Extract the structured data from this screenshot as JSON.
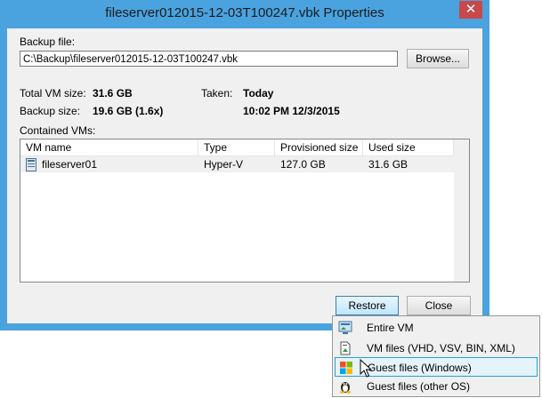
{
  "window": {
    "title": "fileserver012015-12-03T100247.vbk Properties",
    "close_glyph": "✕"
  },
  "backup_file": {
    "label": "Backup file:",
    "path": "C:\\Backup\\fileserver012015-12-03T100247.vbk",
    "browse_label": "Browse..."
  },
  "summary": {
    "total_vm_size_label": "Total VM size:",
    "total_vm_size_value": "31.6 GB",
    "backup_size_label": "Backup size:",
    "backup_size_value": "19.6 GB (1.6x)",
    "taken_label": "Taken:",
    "taken_day": "Today",
    "taken_time": "10:02 PM 12/3/2015"
  },
  "vms": {
    "label": "Contained VMs:",
    "columns": [
      "VM name",
      "Type",
      "Provisioned size",
      "Used size"
    ],
    "rows": [
      {
        "name": "fileserver01",
        "type": "Hyper-V",
        "provisioned": "127.0 GB",
        "used": "31.6 GB",
        "icon": "vm-icon"
      }
    ]
  },
  "buttons": {
    "restore": "Restore",
    "close": "Close"
  },
  "restore_menu": {
    "items": [
      {
        "label": "Entire VM",
        "icon": "entire-vm-icon"
      },
      {
        "label": "VM files (VHD, VSV, BIN, XML)",
        "icon": "vm-files-icon"
      },
      {
        "label": "Guest files (Windows)",
        "icon": "windows-icon",
        "highlighted": true
      },
      {
        "label": "Guest files (other OS)",
        "icon": "linux-icon"
      }
    ]
  },
  "colors": {
    "window_frame": "#4aa3df",
    "close_button": "#c7494b",
    "menu_highlight": "#e5f3fb"
  }
}
